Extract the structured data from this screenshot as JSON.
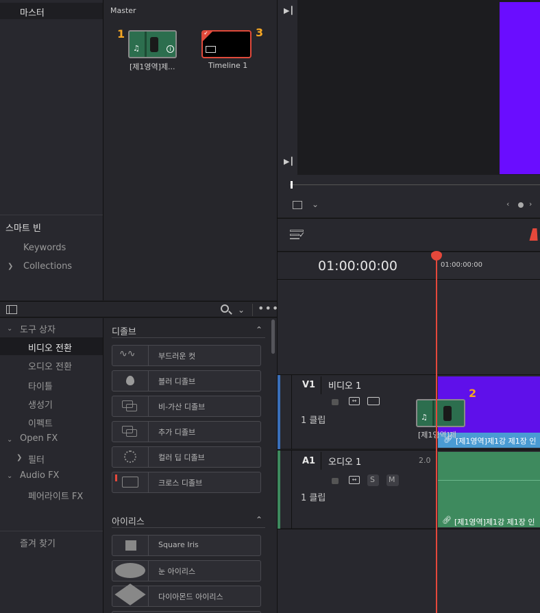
{
  "bin_panel": {
    "master_item": "마스터",
    "smart_bin_title": "스마트 빈",
    "smart_bins": [
      {
        "label": "Keywords"
      },
      {
        "label": "Collections"
      }
    ]
  },
  "media_pool": {
    "title": "Master",
    "clips": [
      {
        "marker": "1",
        "label": "[제1영역]제...",
        "kind": "video"
      },
      {
        "marker": "3",
        "label": "Timeline 1",
        "kind": "timeline"
      }
    ]
  },
  "effects_toolbox": {
    "tree": [
      {
        "label": "도구 상자",
        "expanded": true
      },
      {
        "label": "비디오 전환",
        "selected": true
      },
      {
        "label": "오디오 전환"
      },
      {
        "label": "타이틀"
      },
      {
        "label": "생성기"
      },
      {
        "label": "이펙트"
      },
      {
        "label": "Open FX",
        "expanded": true
      },
      {
        "label": "필터"
      },
      {
        "label": "Audio FX",
        "expanded": true
      },
      {
        "label": "페어라이트 FX"
      }
    ],
    "favorites": "즐겨 찾기"
  },
  "effects_list": {
    "group1_title": "디졸브",
    "group1_items": [
      {
        "label": "부드러운 컷"
      },
      {
        "label": "블러 디졸브"
      },
      {
        "label": "비-가산 디졸브"
      },
      {
        "label": "추가 디졸브"
      },
      {
        "label": "컬러 딥 디졸브"
      },
      {
        "label": "크로스 디졸브"
      }
    ],
    "group2_title": "아이리스",
    "group2_items": [
      {
        "label": "Square Iris"
      },
      {
        "label": "눈 아이리스"
      },
      {
        "label": "다이아몬드 아이리스"
      }
    ]
  },
  "viewer": {
    "purple": "#6a0dff"
  },
  "timeline": {
    "timecode": "01:00:00:00",
    "ruler_tc": "01:00:00:00",
    "tracks": {
      "video": {
        "id": "V1",
        "name": "비디오 1",
        "clip_count": "1 클립",
        "clip_label": "[제1영역]제1강 제1장 인",
        "drag_label": "[제1영역]제"
      },
      "audio": {
        "id": "A1",
        "name": "오디오 1",
        "channels": "2.0",
        "clip_count": "1 클립",
        "clip_label": "[제1영역]제1강 제1장 인",
        "solo": "S",
        "mute": "M"
      }
    },
    "marker2": "2"
  },
  "colors": {
    "playhead": "#e5483b",
    "video_clip": "#5f10ea",
    "audio_clip": "#3e8a5e",
    "accent_orange": "#f5a623"
  }
}
